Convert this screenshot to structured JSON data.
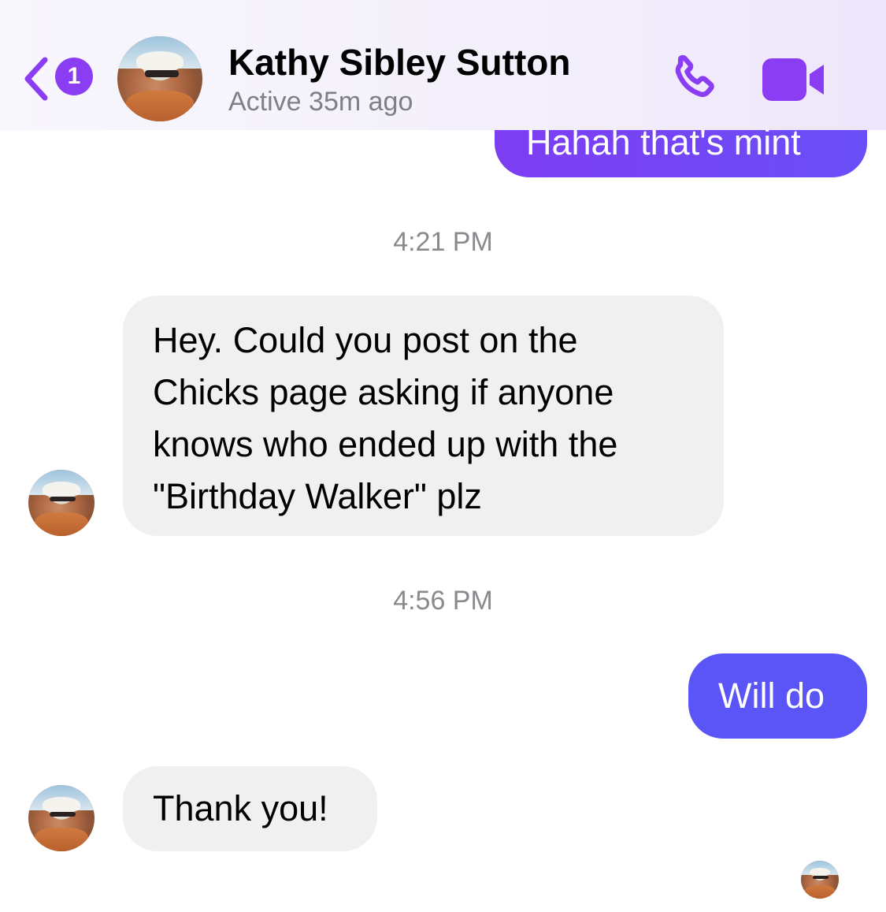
{
  "header": {
    "unread_count": "1",
    "contact_name": "Kathy Sibley Sutton",
    "status": "Active 35m ago"
  },
  "messages": [
    {
      "direction": "outgoing",
      "text": "Hahah that's mint"
    },
    {
      "type": "timestamp",
      "text": "4:21 PM"
    },
    {
      "direction": "incoming",
      "lines": [
        "Hey.  Could you post on the",
        "Chicks page asking if anyone",
        "knows who ended up with the",
        "\"Birthday Walker\" plz"
      ]
    },
    {
      "type": "timestamp",
      "text": "4:56 PM"
    },
    {
      "direction": "outgoing",
      "text": "Will do"
    },
    {
      "direction": "incoming",
      "text": "Thank you!"
    }
  ],
  "colors": {
    "accent": "#8a3df2",
    "outgoing_bubble": "#6a4ef7",
    "incoming_bubble": "#f0f0f1"
  },
  "icons": [
    "back-chevron-icon",
    "phone-icon",
    "video-camera-icon"
  ]
}
